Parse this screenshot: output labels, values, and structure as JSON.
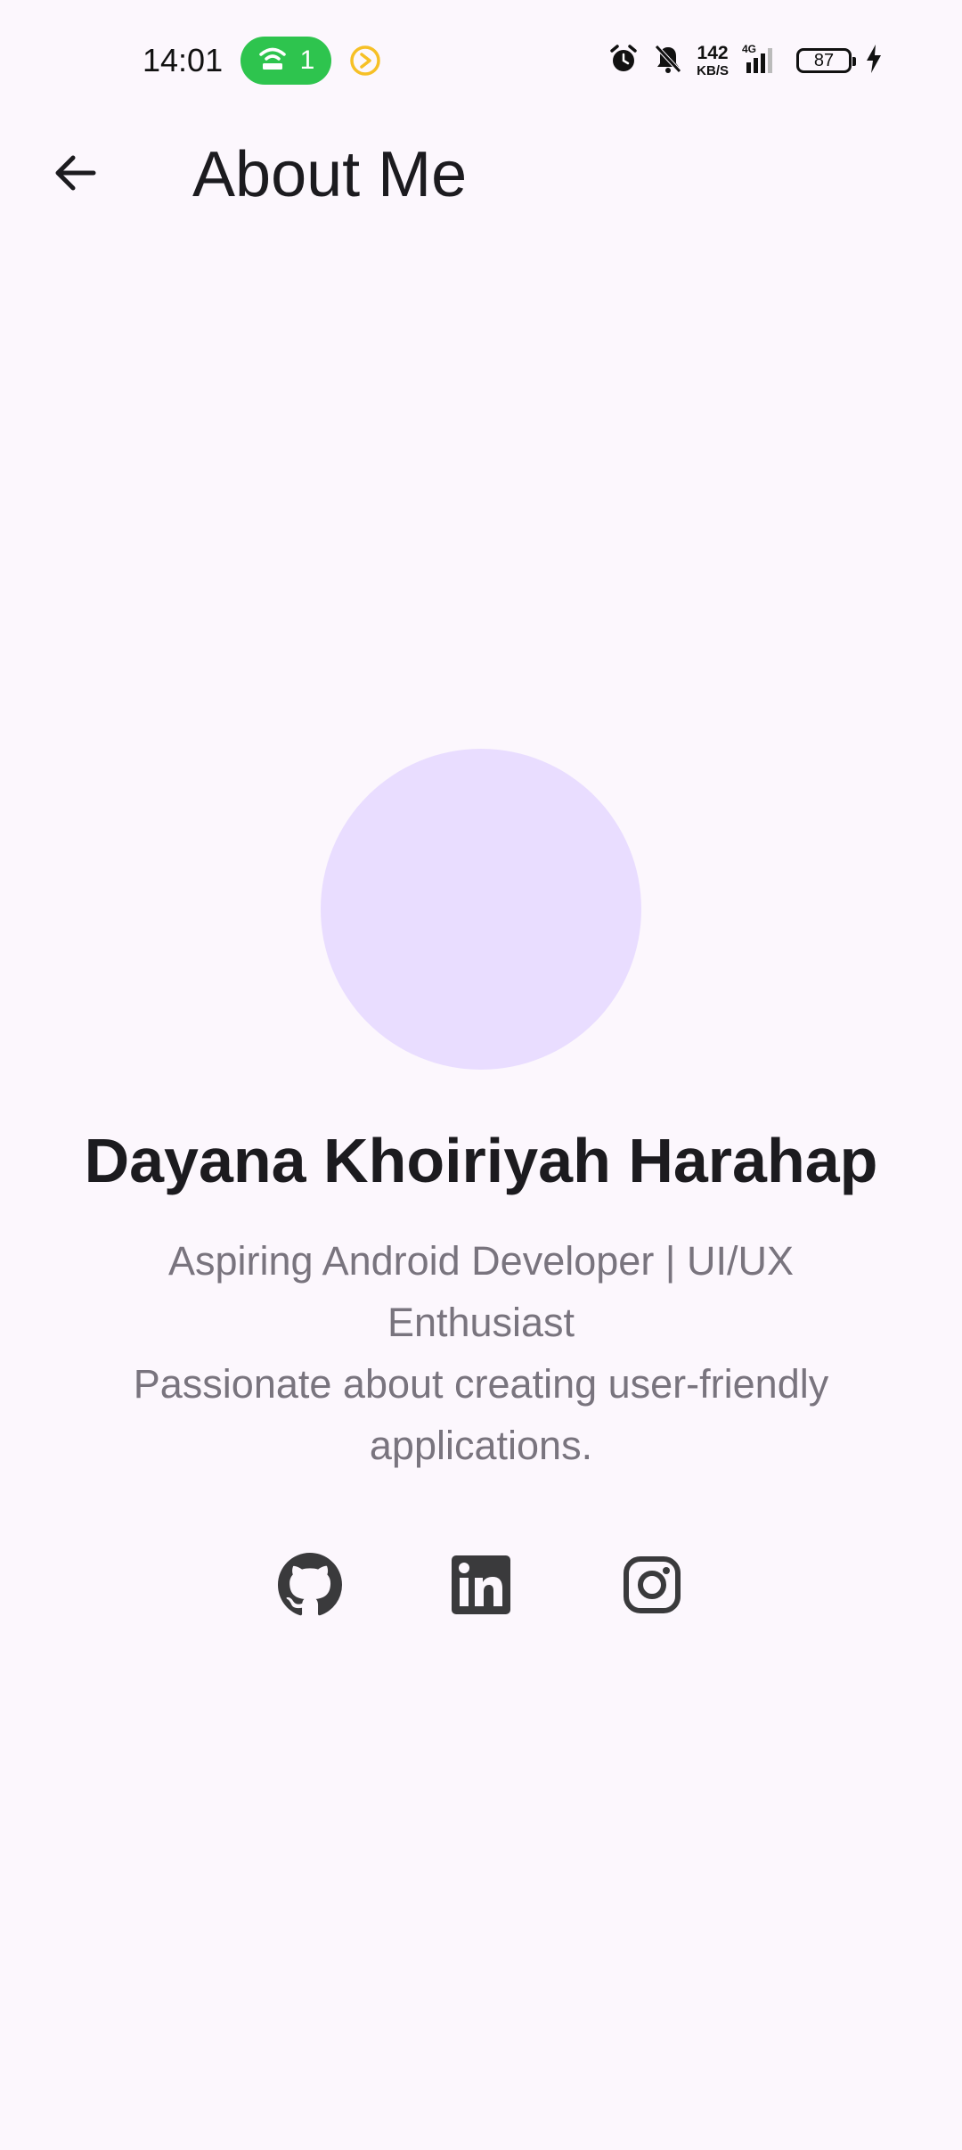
{
  "status_bar": {
    "time": "14:01",
    "hotspot_count": "1",
    "network_speed_value": "142",
    "network_speed_unit": "KB/S",
    "network_type": "4G",
    "battery_level": "87",
    "icons": [
      "hotspot-icon",
      "media-play-icon",
      "alarm-icon",
      "mute-icon",
      "signal-icon",
      "battery-icon",
      "charging-icon"
    ]
  },
  "app_bar": {
    "title": "About Me",
    "back_icon": "arrow-back-icon"
  },
  "profile": {
    "name": "Dayana Khoiriyah Harahap",
    "bio": "Aspiring Android Developer | UI/UX Enthusiast\nPassionate about creating user-friendly applications."
  },
  "social": {
    "links": [
      "github-icon",
      "linkedin-icon",
      "instagram-icon"
    ]
  },
  "colors": {
    "background": "#fcf7fd",
    "avatar_fill": "#e9ddff",
    "hotspot_green": "#2ec44e",
    "accent_yellow": "#f6c026",
    "bio_text": "#79747e",
    "icon_dark": "#3a3a3c"
  }
}
